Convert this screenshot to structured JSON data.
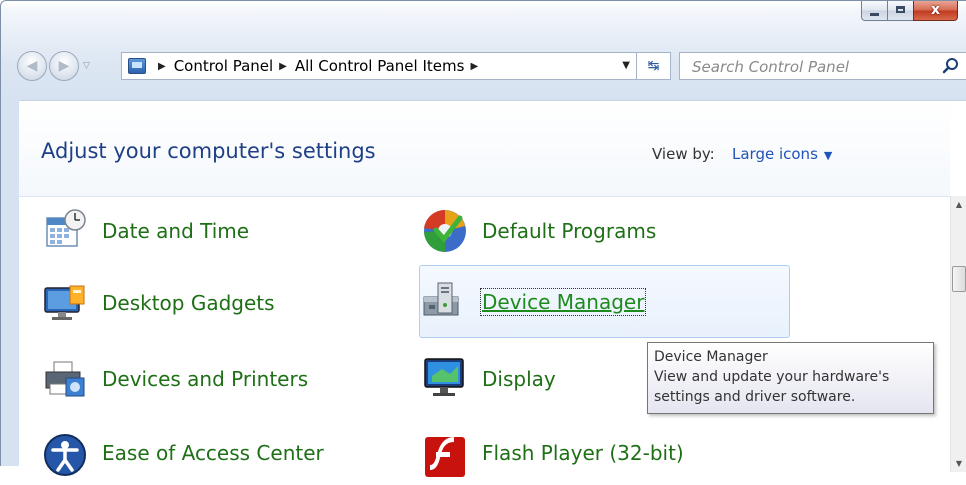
{
  "window": {
    "controls": {
      "minimize_icon": "minimize-icon",
      "maximize_icon": "maximize-icon",
      "close_glyph": "x"
    }
  },
  "navigation": {
    "back_icon": "back-arrow-icon",
    "forward_icon": "forward-arrow-icon",
    "breadcrumb": [
      "Control Panel",
      "All Control Panel Items"
    ],
    "refresh_icon": "refresh-icon",
    "search_placeholder": "Search Control Panel"
  },
  "header": {
    "title": "Adjust your computer's settings",
    "view_by_label": "View by:",
    "view_by_value": "Large icons"
  },
  "items": [
    {
      "label": "Date and Time",
      "icon": "calendar-clock-icon"
    },
    {
      "label": "Default Programs",
      "icon": "default-programs-icon"
    },
    {
      "label": "Desktop Gadgets",
      "icon": "desktop-gadgets-icon"
    },
    {
      "label": "Device Manager",
      "icon": "device-manager-icon",
      "state": "hover"
    },
    {
      "label": "Devices and Printers",
      "icon": "printer-icon"
    },
    {
      "label": "Display",
      "icon": "display-monitor-icon"
    },
    {
      "label": "Ease of Access Center",
      "icon": "ease-of-access-icon"
    },
    {
      "label": "Flash Player (32-bit)",
      "icon": "flash-player-icon"
    }
  ],
  "tooltip": {
    "title": "Device Manager",
    "line1": "View and update your hardware's",
    "line2": "settings and driver software."
  },
  "colors": {
    "title_blue": "#1f3f86",
    "link_green": "#1e6f16",
    "link_blue": "#1f54b8",
    "hover_border": "#aecdf3"
  }
}
